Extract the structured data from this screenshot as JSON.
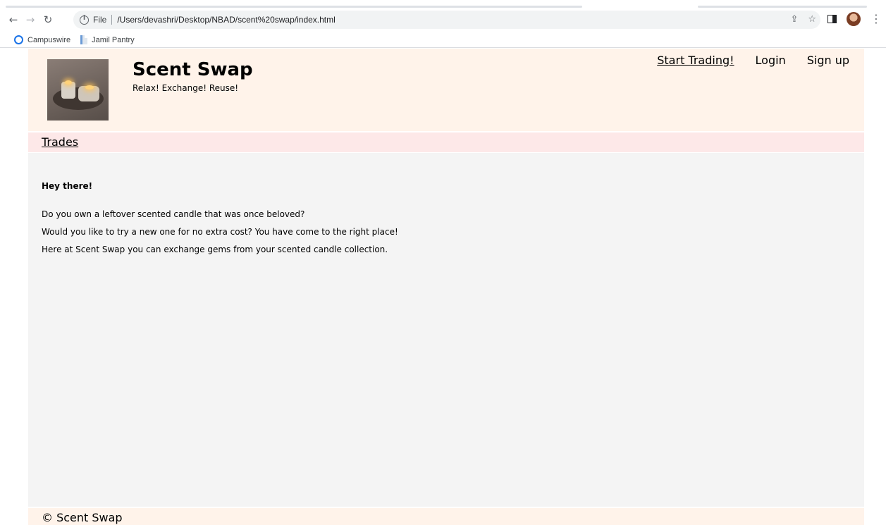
{
  "browser": {
    "url_scheme": "File",
    "url": "/Users/devashri/Desktop/NBAD/scent%20swap/index.html",
    "bookmarks": [
      {
        "label": "Campuswire",
        "icon": "campuswire-icon"
      },
      {
        "label": "Jamil Pantry",
        "icon": "document-icon"
      }
    ]
  },
  "header": {
    "title": "Scent Swap",
    "tagline": "Relax! Exchange! Reuse!",
    "nav": {
      "start_trading": "Start Trading!",
      "login": "Login",
      "signup": "Sign up"
    }
  },
  "subnav": {
    "trades": "Trades"
  },
  "main": {
    "greeting": "Hey there!",
    "paragraphs": [
      "Do you own a leftover scented candle that was once beloved?",
      "Would you like to try a new one for no extra cost? You have come to the right place!",
      "Here at Scent Swap you can exchange gems from your scented candle collection."
    ]
  },
  "footer": {
    "copyright": "© Scent Swap"
  },
  "icons": {
    "back": "arrow-left-icon",
    "forward": "arrow-right-icon",
    "reload": "reload-icon",
    "info": "info-icon",
    "share": "share-icon",
    "bookmark": "star-icon",
    "side_panel": "side-panel-icon",
    "profile": "profile-avatar",
    "menu": "kebab-menu-icon"
  }
}
